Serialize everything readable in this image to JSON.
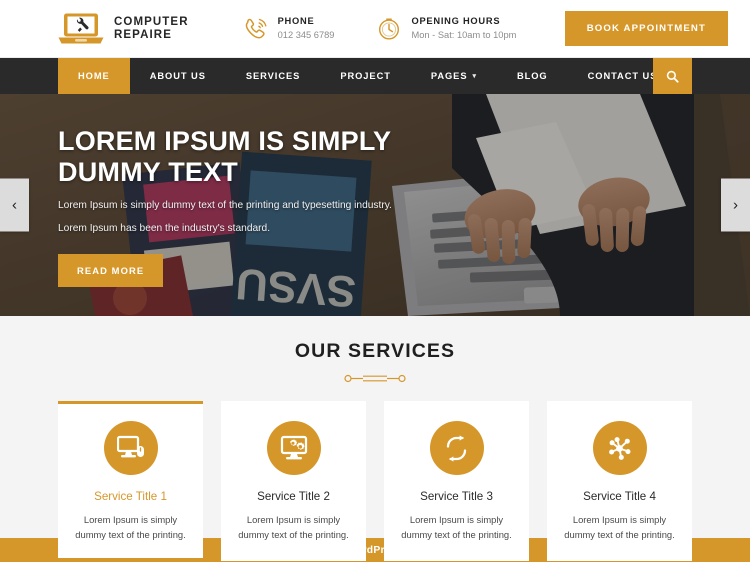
{
  "header": {
    "logo_icon": "laptop-wrench-icon",
    "brand_line1": "COMPUTER",
    "brand_line2": "REPAIRE",
    "phone": {
      "icon": "phone-ring-icon",
      "label": "PHONE",
      "value": "012 345 6789"
    },
    "hours": {
      "icon": "clock-icon",
      "label": "OPENING HOURS",
      "value": "Mon - Sat: 10am to 10pm"
    },
    "book_button": "BOOK APPOINTMENT"
  },
  "nav": {
    "items": [
      {
        "label": "HOME",
        "active": true,
        "caret": false
      },
      {
        "label": "ABOUT US",
        "active": false,
        "caret": false
      },
      {
        "label": "SERVICES",
        "active": false,
        "caret": false
      },
      {
        "label": "PROJECT",
        "active": false,
        "caret": false
      },
      {
        "label": "PAGES",
        "active": false,
        "caret": true
      },
      {
        "label": "BLOG",
        "active": false,
        "caret": false
      },
      {
        "label": "CONTACT US",
        "active": false,
        "caret": false
      }
    ],
    "caret_glyph": "▾",
    "search_icon": "search-icon"
  },
  "hero": {
    "title": "LOREM IPSUM IS SIMPLY DUMMY TEXT",
    "subtitle_1": "Lorem Ipsum is simply dummy text of the printing and typesetting industry.",
    "subtitle_2": "Lorem Ipsum has been the industry's standard.",
    "cta": "READ MORE",
    "prev_glyph": "‹",
    "next_glyph": "›"
  },
  "services": {
    "heading": "OUR SERVICES",
    "divider_icon": "ornament-divider",
    "cards": [
      {
        "icon": "monitor-mouse-icon",
        "title": "Service Title 1",
        "desc": "Lorem Ipsum is simply dummy text of the printing.",
        "active": true
      },
      {
        "icon": "monitor-gears-icon",
        "title": "Service Title 2",
        "desc": "Lorem Ipsum is simply dummy text of the printing.",
        "active": false
      },
      {
        "icon": "refresh-arrows-icon",
        "title": "Service Title 3",
        "desc": "Lorem Ipsum is simply dummy text of the printing.",
        "active": false
      },
      {
        "icon": "network-hub-icon",
        "title": "Service Title 4",
        "desc": "Lorem Ipsum is simply dummy text of the printing.",
        "active": false
      }
    ]
  },
  "footer": {
    "text": "Computer Repair WordPress Theme By Luzuk."
  },
  "colors": {
    "accent": "#d6972a",
    "nav_bg": "#2a2a2a",
    "section_bg": "#f4f4f4",
    "card_bg": "#ffffff",
    "text_dark": "#1f1f1f"
  }
}
